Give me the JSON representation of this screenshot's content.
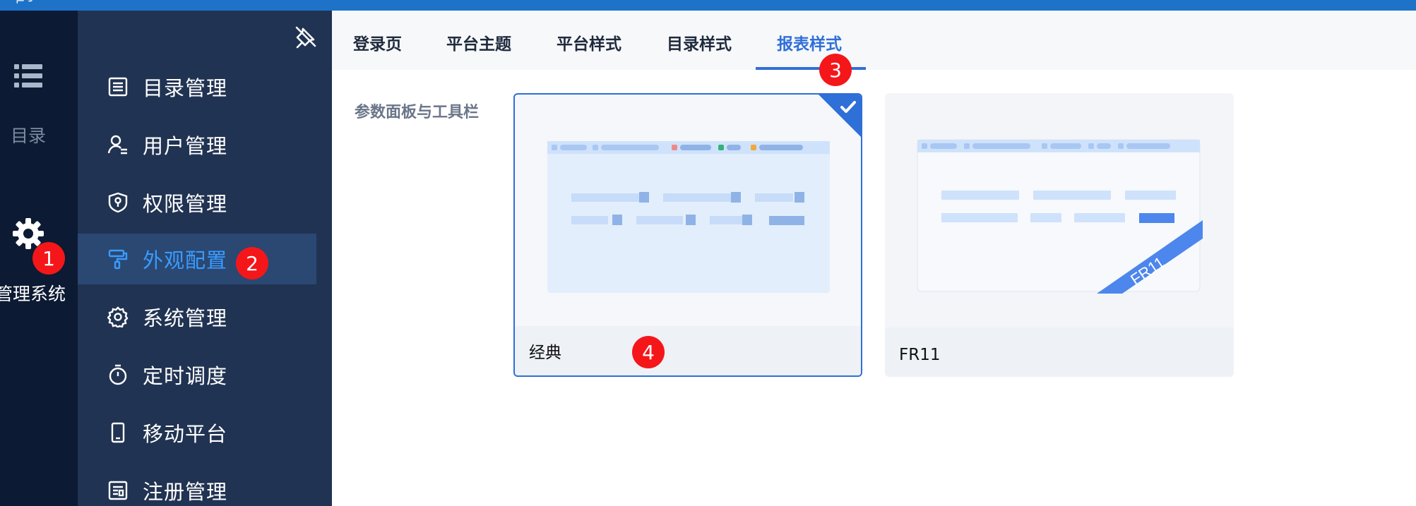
{
  "rail": {
    "directory_label": "目录",
    "system_label": "管理系统"
  },
  "menu": {
    "items": [
      {
        "label": "目录管理",
        "icon": "list-doc-icon"
      },
      {
        "label": "用户管理",
        "icon": "user-icon"
      },
      {
        "label": "权限管理",
        "icon": "shield-icon"
      },
      {
        "label": "外观配置",
        "icon": "paint-roller-icon"
      },
      {
        "label": "系统管理",
        "icon": "gear-icon"
      },
      {
        "label": "定时调度",
        "icon": "stopwatch-icon"
      },
      {
        "label": "移动平台",
        "icon": "mobile-icon"
      },
      {
        "label": "注册管理",
        "icon": "register-icon"
      }
    ]
  },
  "tabs": [
    "登录页",
    "平台主题",
    "平台样式",
    "目录样式",
    "报表样式"
  ],
  "section": {
    "label": "参数面板与工具栏"
  },
  "cards": [
    {
      "label": "经典",
      "selected": true
    },
    {
      "label": "FR11",
      "ribbon": "FR11",
      "selected": false
    }
  ],
  "badges": [
    "1",
    "2",
    "3",
    "4"
  ],
  "colors": {
    "accent": "#2f6fd8",
    "rail_bg": "#0c1a33",
    "menu_bg": "#213352",
    "active_text": "#3a9bff",
    "badge": "#f5161a"
  }
}
